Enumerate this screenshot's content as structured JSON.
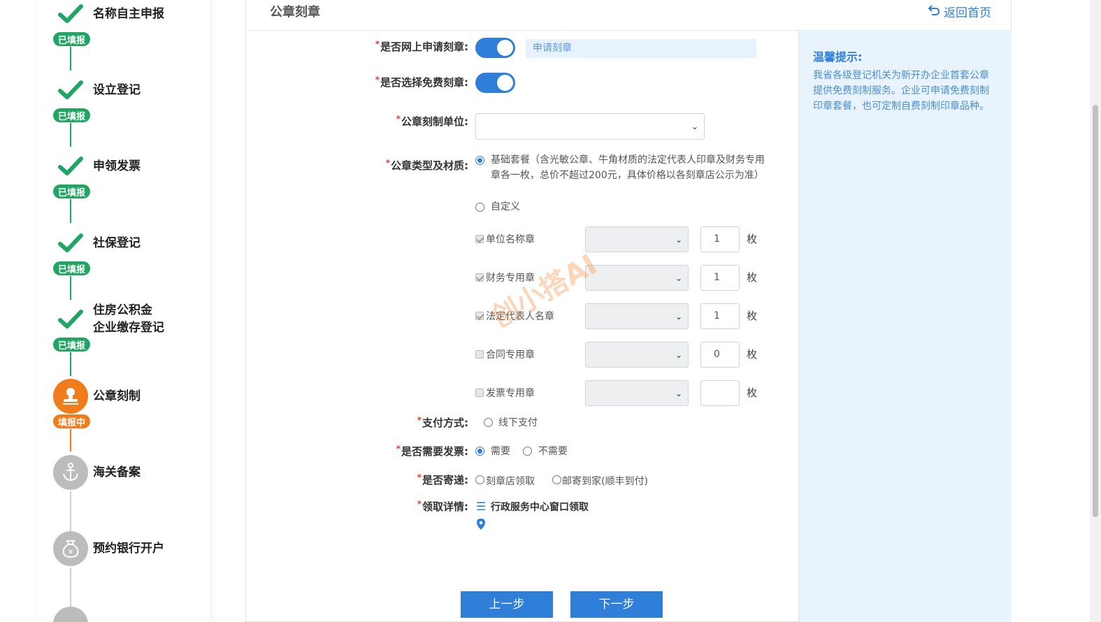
{
  "sidebar": {
    "steps": [
      {
        "name": "名称自主申报",
        "badge": "已填报",
        "status": "done",
        "icon": "check-icon"
      },
      {
        "name": "设立登记",
        "badge": "已填报",
        "status": "done",
        "icon": "check-icon"
      },
      {
        "name": "申领发票",
        "badge": "已填报",
        "status": "done",
        "icon": "check-icon"
      },
      {
        "name": "社保登记",
        "badge": "已填报",
        "status": "done",
        "icon": "check-icon"
      },
      {
        "name": "住房公积金",
        "name2": "企业缴存登记",
        "badge": "已填报",
        "status": "done",
        "icon": "check-icon"
      },
      {
        "name": "公章刻制",
        "badge": "填报中",
        "status": "active",
        "icon": "seal-icon"
      },
      {
        "name": "海关备案",
        "status": "todo",
        "icon": "anchor-icon"
      },
      {
        "name": "预约银行开户",
        "status": "todo",
        "icon": "money-bag-icon"
      }
    ]
  },
  "header": {
    "title": "公章刻章",
    "back_label": "返回首页"
  },
  "form": {
    "online_apply": {
      "label": "是否网上申请刻章:",
      "on": true,
      "hint": "申请刻章"
    },
    "free_seal": {
      "label": "是否选择免费刻章:",
      "on": true
    },
    "seal_unit": {
      "label": "公章刻制单位:",
      "value": ""
    },
    "seal_type": {
      "label": "公章类型及材质:",
      "option_basic": "基础套餐（含光敏公章、牛角材质的法定代表人印章及财务专用章各一枚，总价不超过200元，具体价格以各刻章店公示为准）",
      "option_custom": "自定义"
    },
    "seals": [
      {
        "name": "单位名称章",
        "checked": true,
        "qty": "1",
        "unit": "枚"
      },
      {
        "name": "财务专用章",
        "checked": true,
        "qty": "1",
        "unit": "枚"
      },
      {
        "name": "法定代表人名章",
        "checked": true,
        "qty": "1",
        "unit": "枚"
      },
      {
        "name": "合同专用章",
        "checked": false,
        "qty": "0",
        "unit": "枚"
      },
      {
        "name": "发票专用章",
        "checked": false,
        "qty": "",
        "unit": "枚"
      }
    ],
    "payment": {
      "label": "支付方式:",
      "option": "线下支付"
    },
    "invoice": {
      "label": "是否需要发票:",
      "yes": "需要",
      "no": "不需要"
    },
    "delivery": {
      "label": "是否寄递:",
      "opt1": "刻章店领取",
      "opt2": "邮寄到家(顺丰到付)"
    },
    "pickup": {
      "label": "领取详情:",
      "value": "行政服务中心窗口领取"
    },
    "prev_label": "上一步",
    "next_label": "下一步"
  },
  "tips": {
    "title": "温馨提示:",
    "body": "我省各级登记机关为新开办企业首套公章提供免费刻制服务。企业可申请免费刻制印章套餐，也可定制自费刻制印章品种。"
  },
  "watermark": "创小搭AI",
  "colors": {
    "primary": "#2f7fd8",
    "done": "#21a563",
    "active": "#f07c1b",
    "todo": "#bcbcbc",
    "tips_bg": "#e8f3fd"
  }
}
